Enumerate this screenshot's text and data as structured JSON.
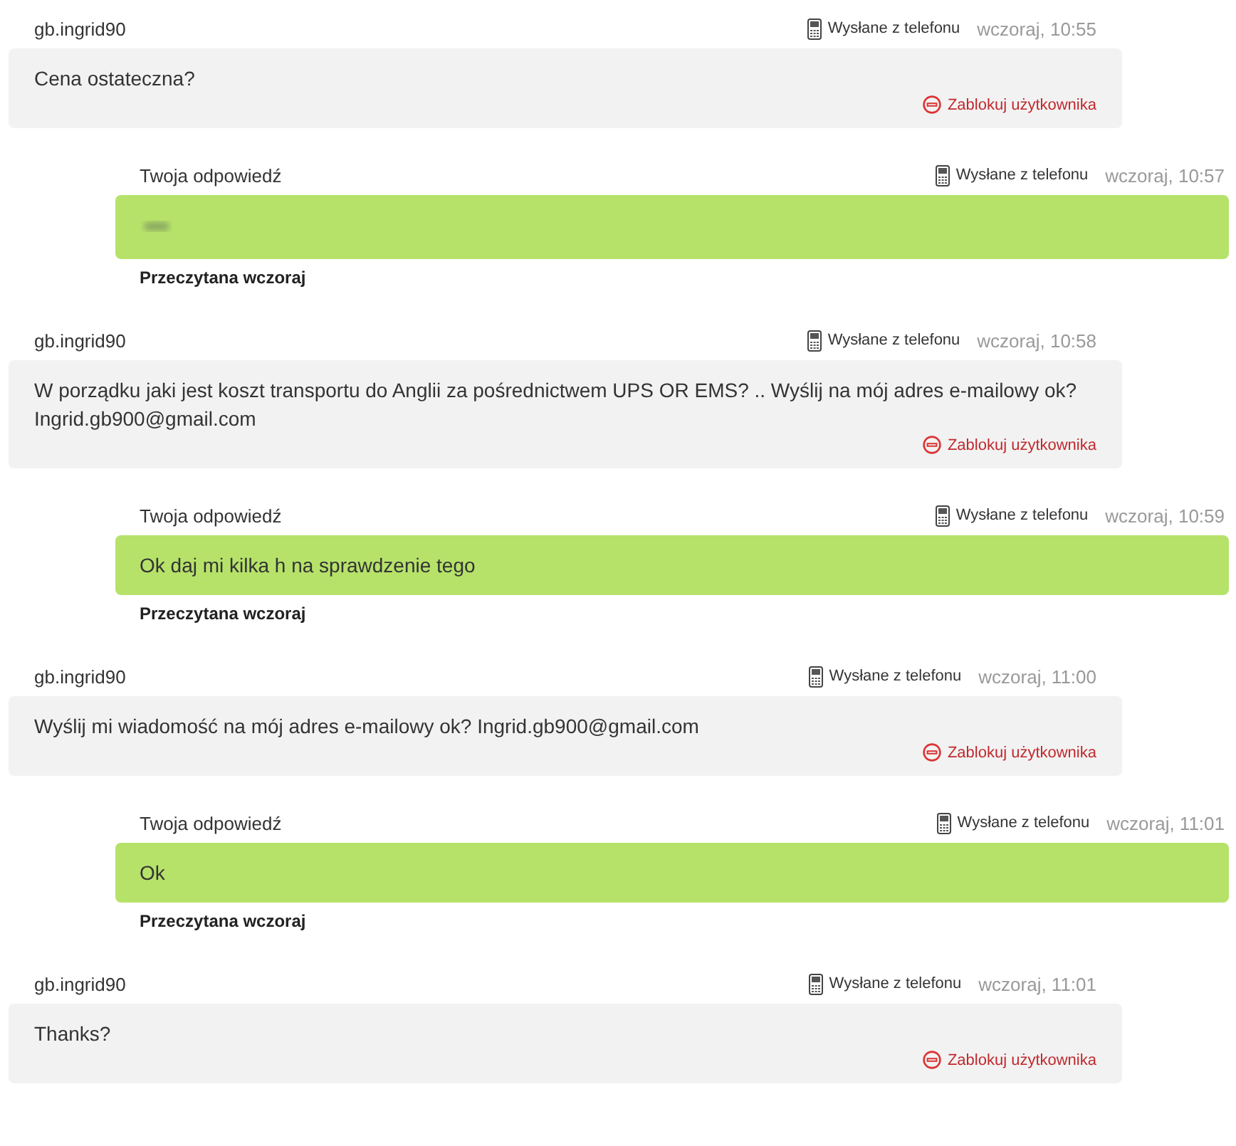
{
  "messages": [
    {
      "kind": "incoming",
      "author": "gb.ingrid90",
      "device": "Wysłane z telefonu",
      "time": "wczoraj, 10:55",
      "text": "Cena ostateczna?",
      "block": "Zablokuj użytkownika"
    },
    {
      "kind": "reply",
      "author": "Twoja odpowiedź",
      "device": "Wysłane z telefonu",
      "time": "wczoraj, 10:57",
      "redacted": true,
      "status": "Przeczytana wczoraj"
    },
    {
      "kind": "incoming",
      "author": "gb.ingrid90",
      "device": "Wysłane z telefonu",
      "time": "wczoraj, 10:58",
      "text": "W porządku jaki jest koszt transportu do Anglii za pośrednictwem UPS OR EMS? .. Wyślij na mój adres e-mailowy ok? Ingrid.gb900@gmail.com",
      "block": "Zablokuj użytkownika"
    },
    {
      "kind": "reply",
      "author": "Twoja odpowiedź",
      "device": "Wysłane z telefonu",
      "time": "wczoraj, 10:59",
      "text": "Ok daj mi kilka h na sprawdzenie tego",
      "redacted": false,
      "status": "Przeczytana wczoraj"
    },
    {
      "kind": "incoming",
      "author": "gb.ingrid90",
      "device": "Wysłane z telefonu",
      "time": "wczoraj, 11:00",
      "text": "Wyślij mi wiadomość na mój adres e-mailowy ok? Ingrid.gb900@gmail.com",
      "block": "Zablokuj użytkownika"
    },
    {
      "kind": "reply",
      "author": "Twoja odpowiedź",
      "device": "Wysłane z telefonu",
      "time": "wczoraj, 11:01",
      "text": "Ok",
      "redacted": false,
      "status": "Przeczytana wczoraj"
    },
    {
      "kind": "incoming",
      "author": "gb.ingrid90",
      "device": "Wysłane z telefonu",
      "time": "wczoraj, 11:01",
      "text": "Thanks?",
      "block": "Zablokuj użytkownika"
    }
  ]
}
